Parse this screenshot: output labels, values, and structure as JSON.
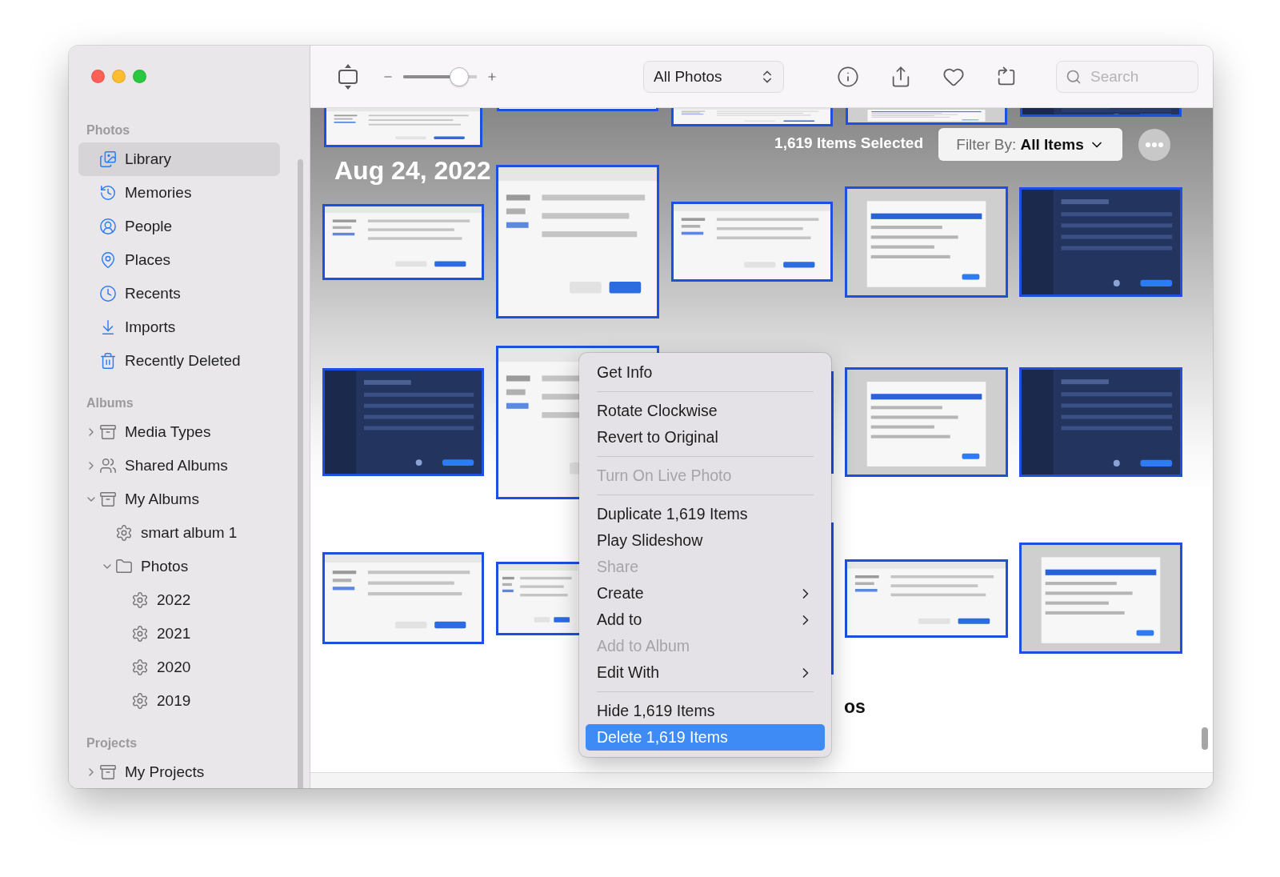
{
  "sidebar": {
    "sections": [
      {
        "title": "Photos",
        "items": [
          {
            "label": "Library",
            "kind": "library",
            "selected": true
          },
          {
            "label": "Memories",
            "kind": "memories",
            "selected": false
          },
          {
            "label": "People",
            "kind": "people",
            "selected": false
          },
          {
            "label": "Places",
            "kind": "places",
            "selected": false
          },
          {
            "label": "Recents",
            "kind": "recents",
            "selected": false
          },
          {
            "label": "Imports",
            "kind": "imports",
            "selected": false
          },
          {
            "label": "Recently Deleted",
            "kind": "trash",
            "selected": false
          }
        ]
      },
      {
        "title": "Albums",
        "items": [
          {
            "label": "Media Types",
            "kind": "albums",
            "expanded": false,
            "selected": false
          },
          {
            "label": "Shared Albums",
            "kind": "shared",
            "expanded": false,
            "selected": false
          },
          {
            "label": "My Albums",
            "kind": "albums",
            "expanded": true,
            "selected": false,
            "children": [
              {
                "label": "smart album 1",
                "kind": "smart",
                "selected": false
              },
              {
                "label": "Photos",
                "kind": "folder",
                "expanded": true,
                "selected": false,
                "children": [
                  {
                    "label": "2022",
                    "kind": "smart",
                    "selected": false
                  },
                  {
                    "label": "2021",
                    "kind": "smart",
                    "selected": false
                  },
                  {
                    "label": "2020",
                    "kind": "smart",
                    "selected": false
                  },
                  {
                    "label": "2019",
                    "kind": "smart",
                    "selected": false
                  }
                ]
              }
            ]
          }
        ]
      },
      {
        "title": "Projects",
        "items": [
          {
            "label": "My Projects",
            "kind": "albums",
            "expanded": false,
            "selected": false
          }
        ]
      }
    ]
  },
  "toolbar": {
    "zoom_slider": {
      "level": 0.76
    },
    "view_menu": {
      "value": "All Photos"
    },
    "search": {
      "placeholder": "Search"
    }
  },
  "selection_bar": {
    "count": "1,619 Items Selected",
    "filter": "Filter By: **All Items**"
  },
  "grid": {
    "date": "Aug 24, 2022",
    "rows": [
      {
        "photos": [
          {
            "kind": "picture",
            "selected": true
          },
          {
            "kind": "picture",
            "selected": true
          },
          {
            "kind": "picture",
            "selected": true
          },
          {
            "kind": "picture",
            "selected": true
          },
          {
            "kind": "picture",
            "selected": true
          }
        ]
      },
      {
        "photos": [
          {
            "kind": "picture",
            "selected": true
          },
          {
            "kind": "picture",
            "selected": true
          },
          {
            "kind": "picture",
            "selected": true
          },
          {
            "kind": "picture",
            "selected": true
          },
          {
            "kind": "picture",
            "selected": true
          }
        ]
      },
      {
        "photos": [
          {
            "kind": "picture",
            "selected": true
          },
          {
            "kind": "picture",
            "selected": true
          },
          {
            "kind": "picture",
            "selected": true
          },
          {
            "kind": "picture",
            "selected": true
          },
          {
            "kind": "picture",
            "selected": true
          }
        ]
      },
      {
        "photos": [
          {
            "kind": "picture",
            "selected": true
          },
          {
            "kind": "picture",
            "selected": true
          },
          {
            "kind": "picture",
            "selected": true
          },
          {
            "kind": "picture",
            "selected": true
          },
          {
            "kind": "picture",
            "selected": true
          }
        ]
      }
    ],
    "section_title": "os"
  },
  "context_menu": {
    "items": [
      {
        "kind": "item",
        "label": "Get Info",
        "disabled": false,
        "submenu": false,
        "selected": false
      },
      {
        "kind": "separator"
      },
      {
        "kind": "item",
        "label": "Rotate Clockwise",
        "disabled": false,
        "submenu": false,
        "selected": false
      },
      {
        "kind": "item",
        "label": "Revert to Original",
        "disabled": false,
        "submenu": false,
        "selected": false
      },
      {
        "kind": "separator"
      },
      {
        "kind": "item",
        "label": "Turn On Live Photo",
        "disabled": true,
        "submenu": false,
        "selected": false
      },
      {
        "kind": "separator"
      },
      {
        "kind": "item",
        "label": "Duplicate 1,619 Items",
        "disabled": false,
        "submenu": false,
        "selected": false
      },
      {
        "kind": "item",
        "label": "Play Slideshow",
        "disabled": false,
        "submenu": false,
        "selected": false
      },
      {
        "kind": "item",
        "label": "Share",
        "disabled": true,
        "submenu": false,
        "selected": false
      },
      {
        "kind": "item",
        "label": "Create",
        "disabled": false,
        "submenu": true,
        "selected": false
      },
      {
        "kind": "item",
        "label": "Add to",
        "disabled": false,
        "submenu": true,
        "selected": false
      },
      {
        "kind": "item",
        "label": "Add to Album",
        "disabled": true,
        "submenu": false,
        "selected": false
      },
      {
        "kind": "item",
        "label": "Edit With",
        "disabled": false,
        "submenu": true,
        "selected": false
      },
      {
        "kind": "separator"
      },
      {
        "kind": "item",
        "label": "Hide 1,619 Items",
        "disabled": false,
        "submenu": false,
        "selected": false
      },
      {
        "kind": "item",
        "label": "Delete 1,619 Items",
        "disabled": false,
        "submenu": false,
        "selected": true
      }
    ]
  }
}
